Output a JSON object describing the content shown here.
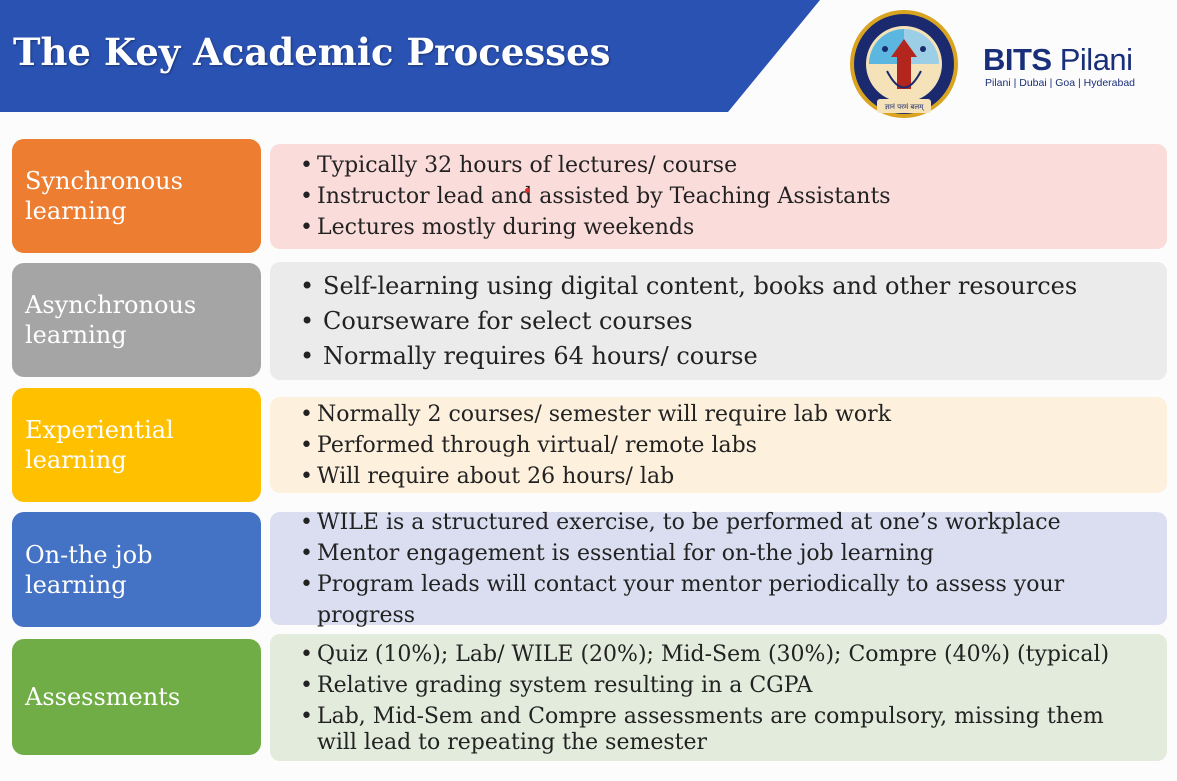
{
  "header": {
    "title": "The Key Academic Processes",
    "bg_color": "#2a52b3"
  },
  "brand": {
    "name_bold": "BITS",
    "name_rest": " Pilani",
    "locations": "Pilani | Dubai | Goa | Hyderabad",
    "emblem_text": "BIRLA INSTITUTE OF TECHNOLOGY & SCIENCE, PILANI",
    "motto": "ज्ञानं परमं बलम्"
  },
  "rows": [
    {
      "label": "Synchronous learning",
      "label_color": "#ed7d31",
      "content_color": "#fadcda",
      "bullets": [
        "Typically 32 hours of lectures/ course",
        "Instructor lead and assisted by Teaching Assistants",
        "Lectures mostly during weekends"
      ]
    },
    {
      "label": "Asynchronous learning",
      "label_color": "#a5a5a5",
      "content_color": "#ebebeb",
      "bullets": [
        "Self-learning using digital content, books and other resources",
        "Courseware for select courses",
        "Normally requires 64 hours/ course"
      ]
    },
    {
      "label": "Experiential learning",
      "label_color": "#ffc000",
      "content_color": "#fdf0dc",
      "bullets": [
        "Normally 2 courses/ semester will require lab work",
        "Performed through virtual/ remote labs",
        "Will require about 26 hours/ lab"
      ]
    },
    {
      "label": "On-the job learning",
      "label_color": "#4472c4",
      "content_color": "#dadef0",
      "bullets": [
        "WILE is a structured exercise, to be performed at one’s workplace",
        "Mentor engagement is essential for on-the job learning",
        "Program leads will contact your mentor periodically to assess your progress"
      ]
    },
    {
      "label": "Assessments",
      "label_color": "#70ad47",
      "content_color": "#e3ebdc",
      "bullets": [
        "Quiz (10%); Lab/ WILE (20%); Mid-Sem (30%); Compre (40%) (typical)",
        "Relative grading system resulting in a CGPA",
        "Lab, Mid-Sem and Compre assessments are compulsory, missing them will lead to repeating the semester"
      ]
    }
  ]
}
